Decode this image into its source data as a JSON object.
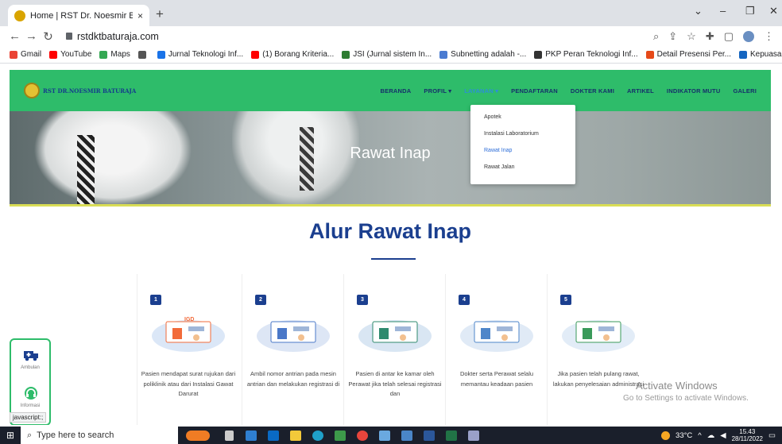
{
  "browser": {
    "tab_title": "Home | RST Dr. Noesmir Baturaja",
    "tab_close": "×",
    "new_tab": "+",
    "url": "rstdktbaturaja.com",
    "window_controls": {
      "chevron": "⌄",
      "minimize": "–",
      "maximize": "❐",
      "close": "✕"
    },
    "bookmarks": [
      {
        "label": "Gmail",
        "color": "#ea4335"
      },
      {
        "label": "YouTube",
        "color": "#ff0000"
      },
      {
        "label": "Maps",
        "color": "#34a853"
      },
      {
        "label": "",
        "color": "#555555"
      },
      {
        "label": "Jurnal Teknologi Inf...",
        "color": "#1a73e8"
      },
      {
        "label": "(1) Borang Kriteria...",
        "color": "#ff0000"
      },
      {
        "label": "JSI (Jurnal sistem In...",
        "color": "#2e7d32"
      },
      {
        "label": "Subnetting adalah -...",
        "color": "#4a7bd1"
      },
      {
        "label": "PKP Peran Teknologi Inf...",
        "color": "#333333"
      },
      {
        "label": "Detail Presensi Per...",
        "color": "#e64a19"
      },
      {
        "label": "Kepuasan Mahasis...",
        "color": "#1565c0"
      }
    ],
    "bookmarks_more": "»"
  },
  "site": {
    "logo_text": "RST DR.NOESMIR BATURAJA",
    "menu": [
      "BERANDA",
      "PROFIL ▾",
      "LAYANAN ▾",
      "PENDAFTARAN",
      "DOKTER KAMI",
      "ARTIKEL",
      "INDIKATOR MUTU",
      "GALERI"
    ],
    "dropdown": [
      "Apotek",
      "Instalasi Laboratorium",
      "Rawat Inap",
      "Rawat Jalan"
    ],
    "hero_title": "Rawat Inap",
    "section_title": "Alur Rawat Inap",
    "steps": [
      {
        "num": "1",
        "desc": "Pasien mendapat surat rujukan dari poliklinik atau dari Instalasi Gawat Darurat"
      },
      {
        "num": "2",
        "desc": "Ambil nomor antrian pada mesin antrian dan melakukan registrasi di"
      },
      {
        "num": "3",
        "desc": "Pasien di antar ke kamar oleh Perawat jika telah selesai registrasi dan"
      },
      {
        "num": "4",
        "desc": "Dokter serta Perawat selalu memantau keadaan pasien"
      },
      {
        "num": "5",
        "desc": "Jika pasien telah pulang rawat, lakukan penyelesaian administrasi"
      }
    ],
    "float": {
      "ambulance": "Ambulan",
      "info": "Informasi"
    },
    "igd_label": "IGD"
  },
  "status_text": "javascript:;",
  "watermark": {
    "line1": "Activate Windows",
    "line2": "Go to Settings to activate Windows."
  },
  "taskbar": {
    "search_placeholder": "Type here to search",
    "temperature": "33°C",
    "time": "15.43",
    "date": "28/11/2022"
  }
}
